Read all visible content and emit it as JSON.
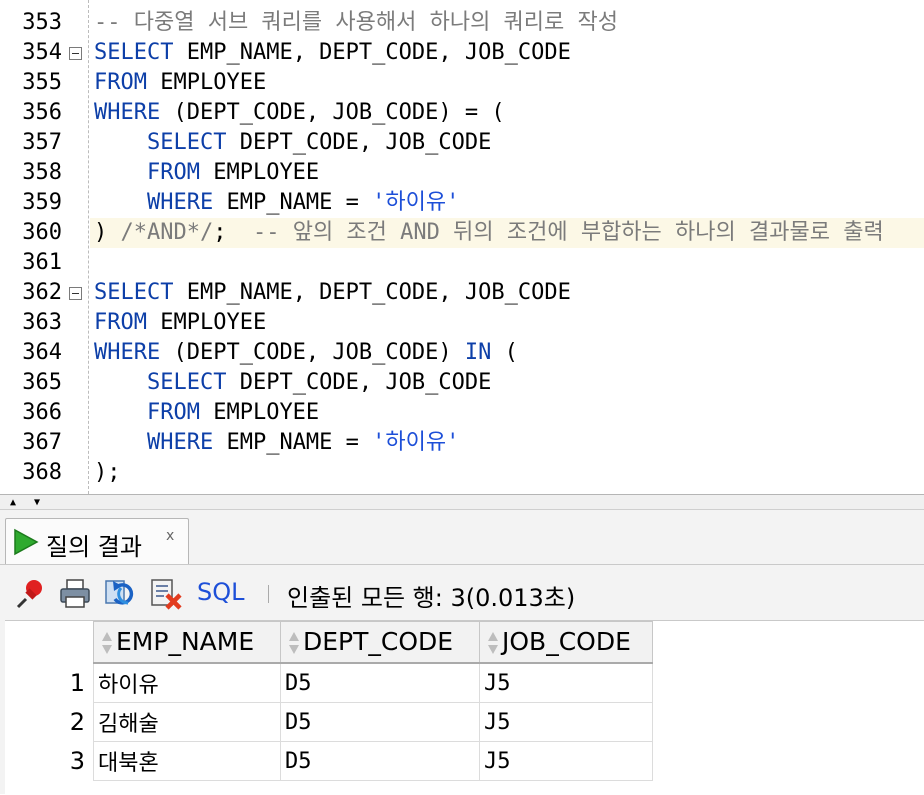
{
  "editor": {
    "lines": [
      {
        "n": "353",
        "parts": [
          {
            "t": "-- 다중열 서브 쿼리를 사용해서 하나의 쿼리로 작성",
            "c": "cm"
          }
        ]
      },
      {
        "n": "354",
        "fold": true,
        "parts": [
          {
            "t": "SELECT",
            "c": "kw"
          },
          {
            "t": " EMP_NAME, DEPT_CODE, JOB_CODE",
            "c": ""
          }
        ]
      },
      {
        "n": "355",
        "parts": [
          {
            "t": "FROM",
            "c": "kw"
          },
          {
            "t": " EMPLOYEE",
            "c": ""
          }
        ]
      },
      {
        "n": "356",
        "parts": [
          {
            "t": "WHERE",
            "c": "kw"
          },
          {
            "t": " (DEPT_CODE, JOB_CODE) = (",
            "c": ""
          }
        ]
      },
      {
        "n": "357",
        "parts": [
          {
            "t": "    ",
            "c": ""
          },
          {
            "t": "SELECT",
            "c": "kw"
          },
          {
            "t": " DEPT_CODE, JOB_CODE",
            "c": ""
          }
        ]
      },
      {
        "n": "358",
        "parts": [
          {
            "t": "    ",
            "c": ""
          },
          {
            "t": "FROM",
            "c": "kw"
          },
          {
            "t": " EMPLOYEE",
            "c": ""
          }
        ]
      },
      {
        "n": "359",
        "parts": [
          {
            "t": "    ",
            "c": ""
          },
          {
            "t": "WHERE",
            "c": "kw"
          },
          {
            "t": " EMP_NAME = ",
            "c": ""
          },
          {
            "t": "'하이유'",
            "c": "str"
          }
        ]
      },
      {
        "n": "360",
        "highlight": true,
        "parts": [
          {
            "t": ") ",
            "c": ""
          },
          {
            "t": "/*AND*/",
            "c": "cm"
          },
          {
            "t": ";  ",
            "c": ""
          },
          {
            "t": "-- 앞의 조건 AND 뒤의 조건에 부합하는 하나의 결과물로 출력",
            "c": "cm"
          }
        ]
      },
      {
        "n": "361",
        "parts": []
      },
      {
        "n": "362",
        "fold": true,
        "parts": [
          {
            "t": "SELECT",
            "c": "kw"
          },
          {
            "t": " EMP_NAME, DEPT_CODE, JOB_CODE",
            "c": ""
          }
        ]
      },
      {
        "n": "363",
        "parts": [
          {
            "t": "FROM",
            "c": "kw"
          },
          {
            "t": " EMPLOYEE",
            "c": ""
          }
        ]
      },
      {
        "n": "364",
        "parts": [
          {
            "t": "WHERE",
            "c": "kw"
          },
          {
            "t": " (DEPT_CODE, JOB_CODE) ",
            "c": ""
          },
          {
            "t": "IN",
            "c": "kw"
          },
          {
            "t": " (",
            "c": ""
          }
        ]
      },
      {
        "n": "365",
        "parts": [
          {
            "t": "    ",
            "c": ""
          },
          {
            "t": "SELECT",
            "c": "kw"
          },
          {
            "t": " DEPT_CODE, JOB_CODE",
            "c": ""
          }
        ]
      },
      {
        "n": "366",
        "parts": [
          {
            "t": "    ",
            "c": ""
          },
          {
            "t": "FROM",
            "c": "kw"
          },
          {
            "t": " EMPLOYEE",
            "c": ""
          }
        ]
      },
      {
        "n": "367",
        "parts": [
          {
            "t": "    ",
            "c": ""
          },
          {
            "t": "WHERE",
            "c": "kw"
          },
          {
            "t": " EMP_NAME = ",
            "c": ""
          },
          {
            "t": "'하이유'",
            "c": "str"
          }
        ]
      },
      {
        "n": "368",
        "parts": [
          {
            "t": ");",
            "c": ""
          }
        ]
      }
    ]
  },
  "results": {
    "tab_label": "질의 결과",
    "tab_close": "x",
    "toolbar": {
      "sql_label": "SQL",
      "status": "인출된 모든 행: 3(0.013초)",
      "icons": [
        "pin-icon",
        "print-icon",
        "refresh-icon",
        "export-icon"
      ]
    },
    "columns": [
      "EMP_NAME",
      "DEPT_CODE",
      "JOB_CODE"
    ],
    "rows": [
      {
        "n": "1",
        "cells": [
          "하이유",
          "D5",
          "J5"
        ]
      },
      {
        "n": "2",
        "cells": [
          "김해술",
          "D5",
          "J5"
        ]
      },
      {
        "n": "3",
        "cells": [
          "대북혼",
          "D5",
          "J5"
        ]
      }
    ]
  },
  "colors": {
    "keyword": "#0d3fa8",
    "string": "#1d4fd8",
    "comment": "#7b7b7b",
    "current_line": "#fcf8e6",
    "play_green": "#2faa2f"
  }
}
